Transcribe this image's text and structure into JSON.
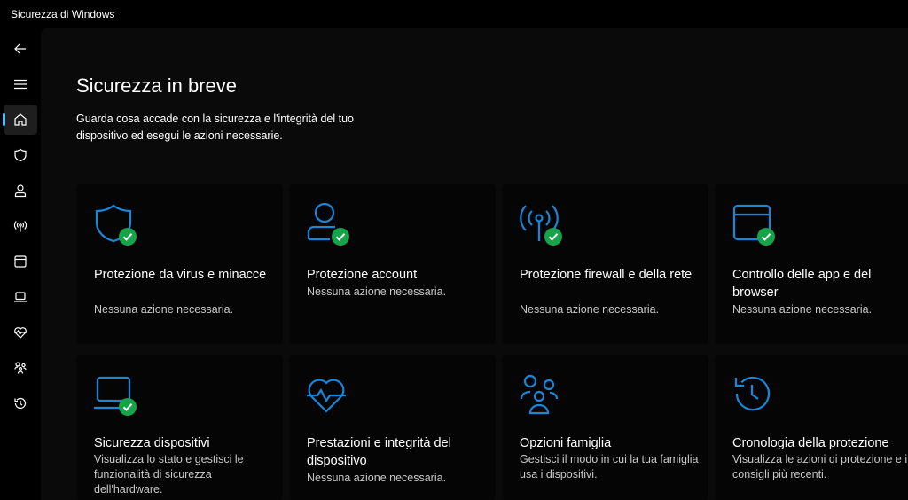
{
  "window": {
    "title": "Sicurezza di Windows"
  },
  "sidebar": {
    "items": [
      {
        "icon": "back-arrow-icon"
      },
      {
        "icon": "hamburger-menu-icon"
      },
      {
        "icon": "home-icon",
        "active": true
      },
      {
        "icon": "shield-icon"
      },
      {
        "icon": "person-icon"
      },
      {
        "icon": "wireless-icon"
      },
      {
        "icon": "app-browser-icon"
      },
      {
        "icon": "laptop-icon"
      },
      {
        "icon": "heart-pulse-icon"
      },
      {
        "icon": "family-icon"
      },
      {
        "icon": "history-icon"
      }
    ]
  },
  "main": {
    "title": "Sicurezza in breve",
    "description": "Guarda cosa accade con la sicurezza e l'integrità del tuo dispositivo ed esegui le azioni necessarie."
  },
  "cards": [
    {
      "icon": "virus-shield-icon",
      "title": "Protezione da virus e minacce",
      "status": "Nessuna azione necessaria.",
      "ok": true
    },
    {
      "icon": "account-icon",
      "title": "Protezione account",
      "status": "Nessuna azione necessaria.",
      "ok": true
    },
    {
      "icon": "firewall-icon",
      "title": "Protezione firewall e della rete",
      "status": "Nessuna azione necessaria.",
      "ok": true
    },
    {
      "icon": "app-browser-icon",
      "title": "Controllo delle app e del browser",
      "status": "Nessuna azione necessaria.",
      "ok": true
    },
    {
      "icon": "device-security-icon",
      "title": "Sicurezza dispositivi",
      "status": "Visualizza lo stato e gestisci le funzionalità di sicurezza dell'hardware.",
      "ok": true
    },
    {
      "icon": "heart-pulse-icon",
      "title": "Prestazioni e integrità del dispositivo",
      "status": "Nessuna azione necessaria.",
      "ok": false
    },
    {
      "icon": "family-icon",
      "title": "Opzioni famiglia",
      "status": "Gestisci il modo in cui la tua famiglia usa i dispositivi.",
      "ok": false
    },
    {
      "icon": "history-icon",
      "title": "Cronologia della protezione",
      "status": "Visualizza le azioni di protezione e i consigli più recenti.",
      "ok": false
    }
  ],
  "colors": {
    "accent": "#4cc2ff",
    "icon_blue": "#1a86d8",
    "check_green": "#16a34a"
  }
}
